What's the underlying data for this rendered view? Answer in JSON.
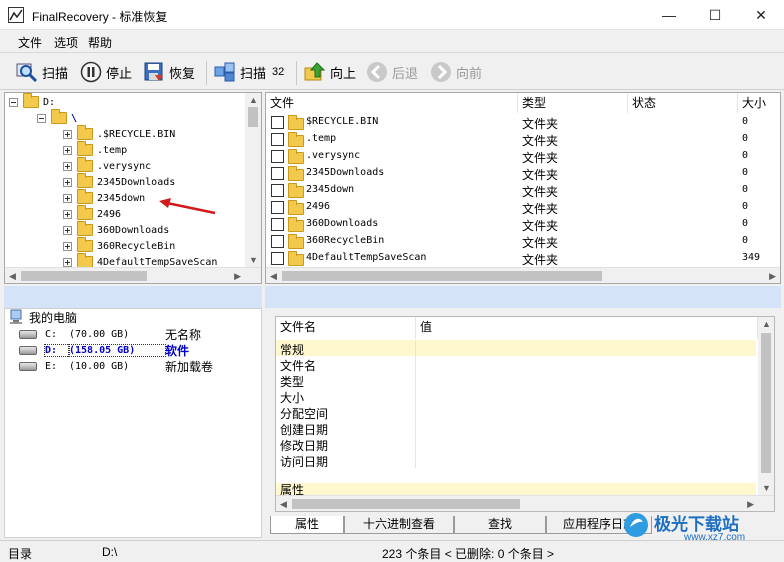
{
  "window": {
    "title": "FinalRecovery - 标准恢复",
    "minimize": "—",
    "maximize": "☐",
    "close": "✕"
  },
  "menu": [
    "文件",
    "选项",
    "帮助"
  ],
  "toolbar": {
    "scan": "扫描",
    "stop": "停止",
    "restore": "恢复",
    "scan32": "扫描",
    "scan32_badge": "32",
    "up": "向上",
    "back": "后退",
    "forward": "向前"
  },
  "tree": {
    "drive": "D:",
    "root": "\\",
    "items": [
      ".$RECYCLE.BIN",
      ".temp",
      ".verysync",
      "2345Downloads",
      "2345down",
      "2496",
      "360Downloads",
      "360RecycleBin",
      "4DefaultTempSaveScan"
    ]
  },
  "files": {
    "columns": [
      "文件",
      "类型",
      "状态",
      "大小"
    ],
    "rows": [
      {
        "name": "$RECYCLE.BIN",
        "type": "文件夹",
        "size": "0"
      },
      {
        "name": ".temp",
        "type": "文件夹",
        "size": "0"
      },
      {
        "name": ".verysync",
        "type": "文件夹",
        "size": "0"
      },
      {
        "name": "2345Downloads",
        "type": "文件夹",
        "size": "0"
      },
      {
        "name": "2345down",
        "type": "文件夹",
        "size": "0"
      },
      {
        "name": "2496",
        "type": "文件夹",
        "size": "0"
      },
      {
        "name": "360Downloads",
        "type": "文件夹",
        "size": "0"
      },
      {
        "name": "360RecycleBin",
        "type": "文件夹",
        "size": "0"
      },
      {
        "name": "4DefaultTempSaveScan",
        "type": "文件夹",
        "size": "349"
      }
    ]
  },
  "drives": {
    "root": "我的电脑",
    "items": [
      {
        "letter": "C:",
        "size": "(70.00 GB)",
        "label": "无名称"
      },
      {
        "letter": "D:",
        "size": "(158.05 GB)",
        "label": "软件"
      },
      {
        "letter": "E:",
        "size": "(10.00 GB)",
        "label": "新加载卷"
      }
    ]
  },
  "properties": {
    "columns": [
      "文件名",
      "值"
    ],
    "rows": [
      "常规",
      "文件名",
      "类型",
      "大小",
      "分配空间",
      "创建日期",
      "修改日期",
      "访问日期"
    ],
    "footer": "属性"
  },
  "tabs": [
    "属性",
    "十六进制查看",
    "查找",
    "应用程序日志"
  ],
  "status": {
    "section": "目录",
    "path": "D:\\",
    "count": "223 个条目 < 已删除: 0 个条目 >"
  },
  "watermark": {
    "brand": "极光下载站",
    "url": "www.xz7.com"
  },
  "colors": {
    "selected_drive": "#0000c8",
    "arrow": "#d21a1a",
    "highlight_row": "#fff8cf",
    "pane_divider": "#d4e3f7"
  }
}
